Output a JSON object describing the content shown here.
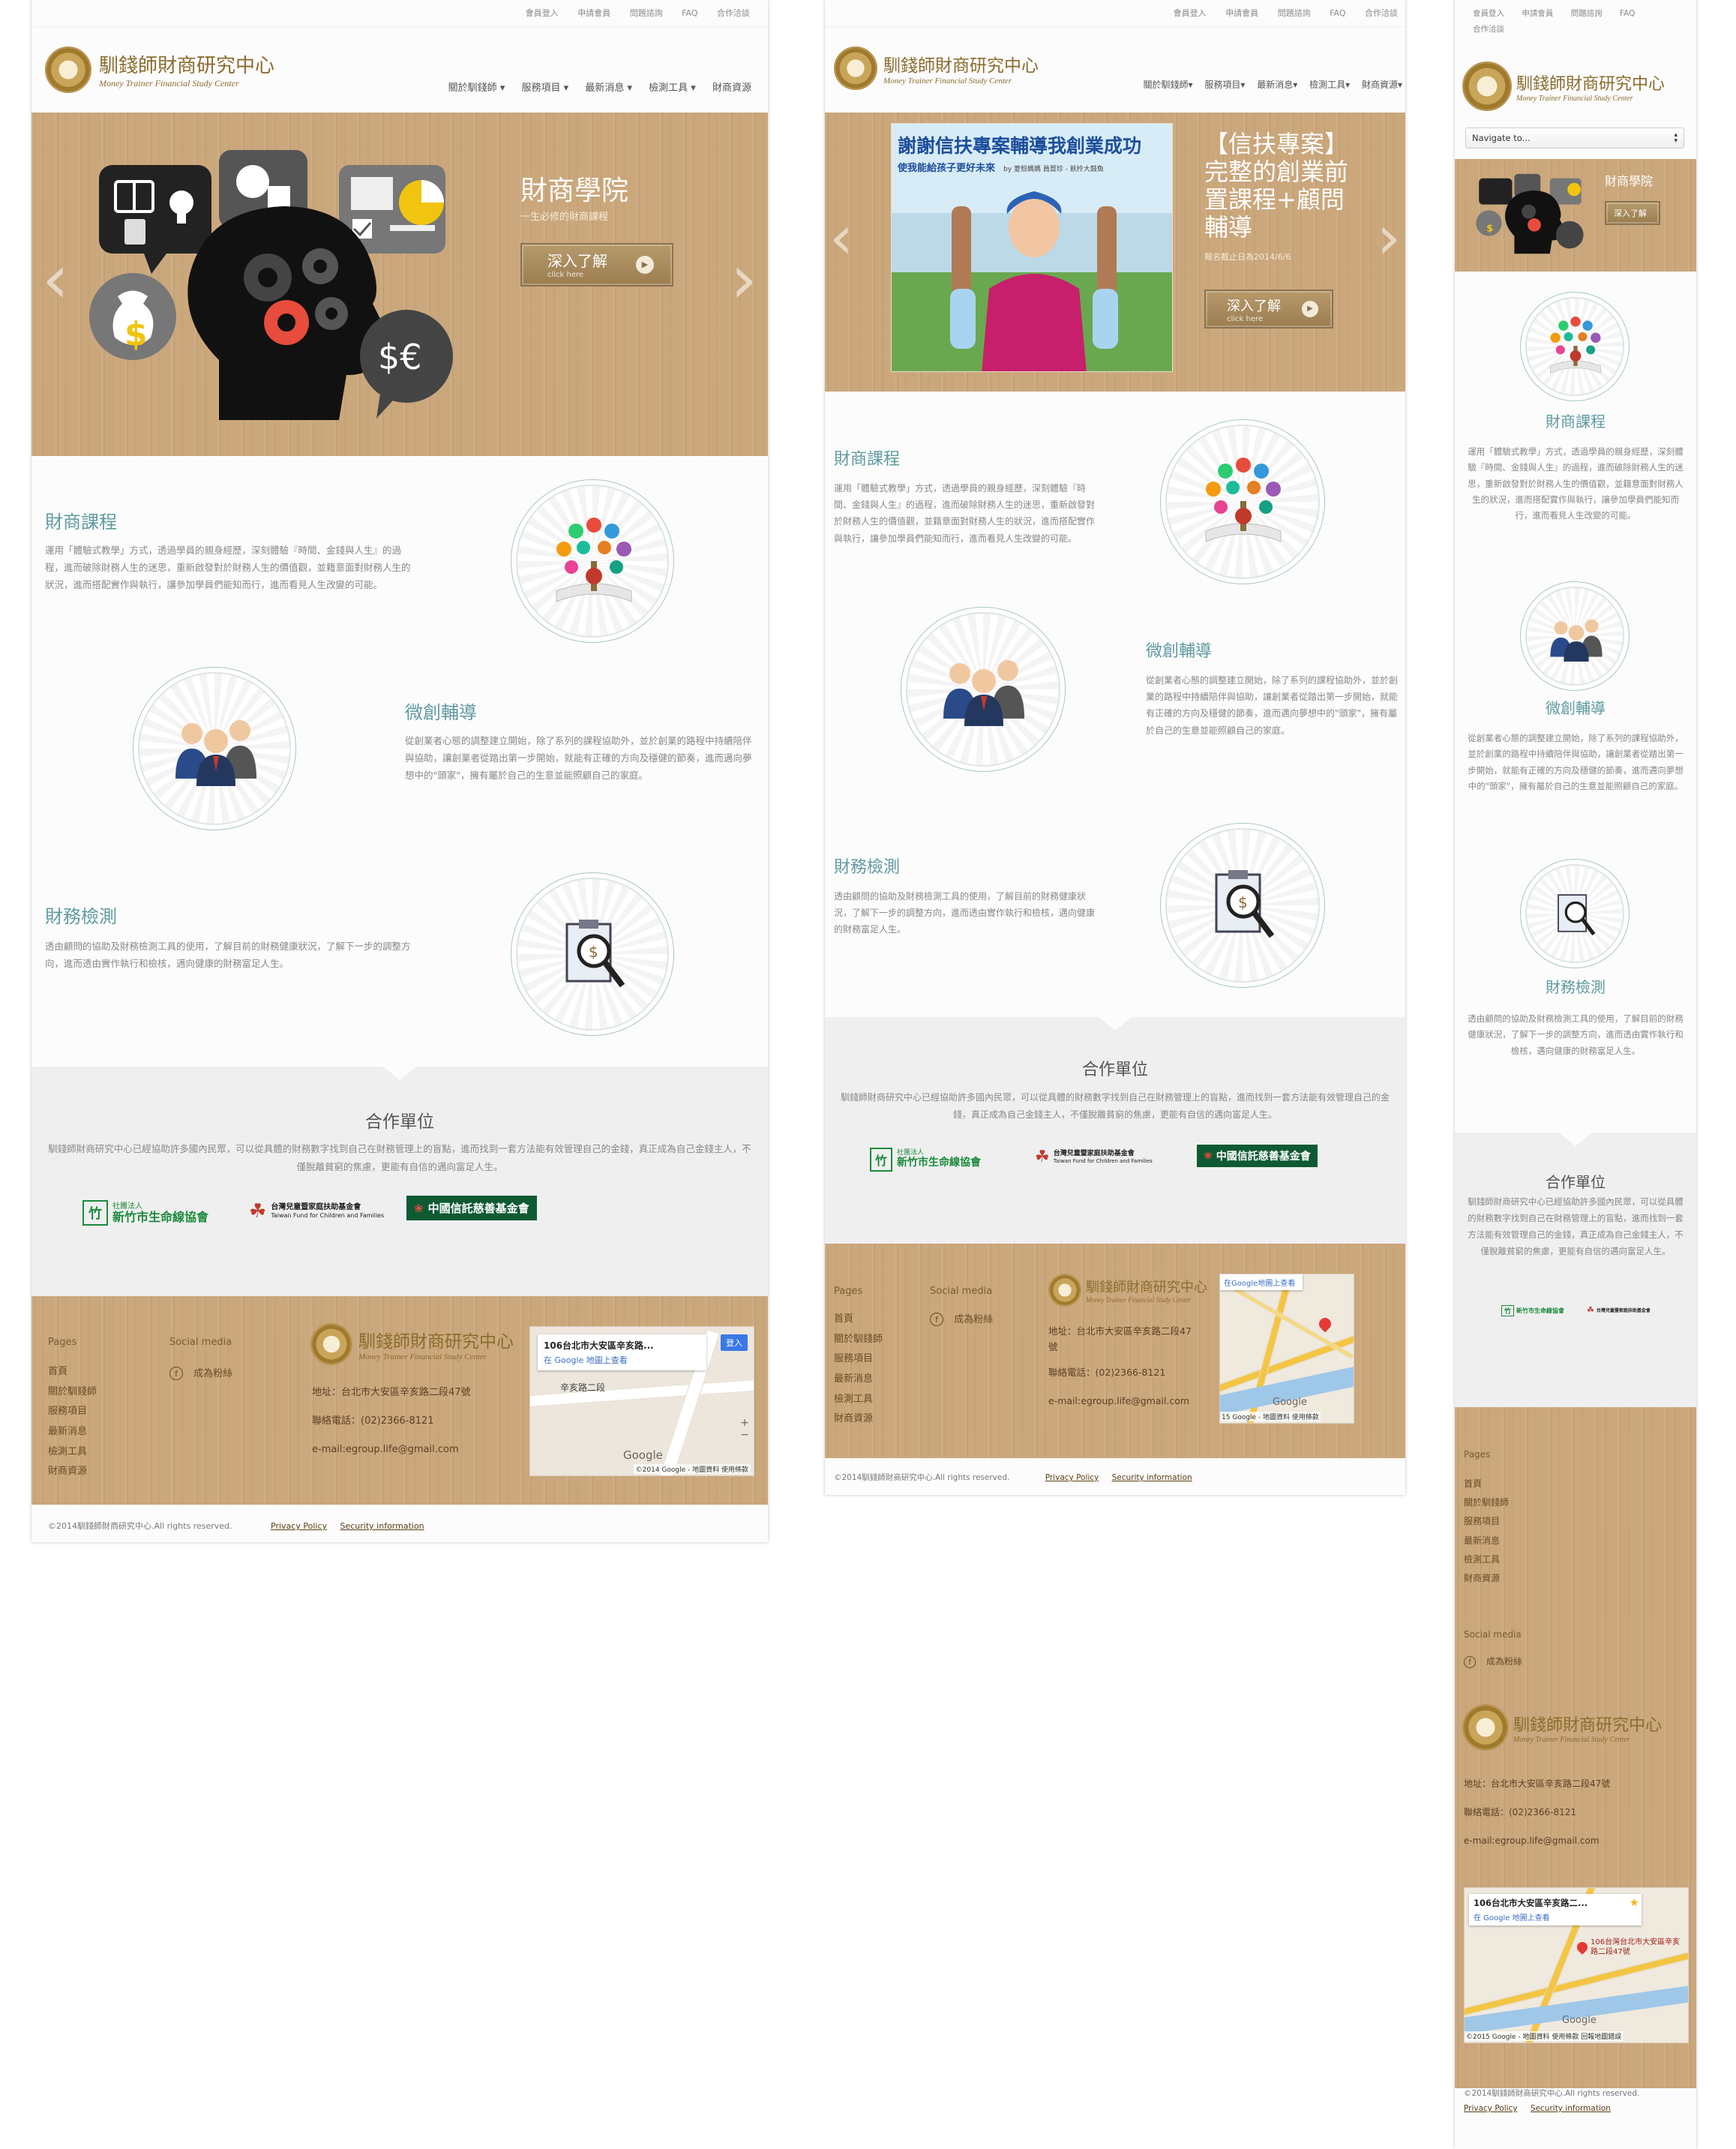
{
  "topbar": {
    "links": [
      "會員登入",
      "申請會員",
      "問題諮詢",
      "FAQ",
      "合作洽談"
    ]
  },
  "logo": {
    "name": "馴錢師財商研究中心",
    "subtitle": "Money Trainer Financial Study Center"
  },
  "nav": {
    "items": [
      "關於馴錢師",
      "服務項目",
      "最新消息",
      "檢測工具",
      "財商資源"
    ]
  },
  "mobile_nav": {
    "select_value": "Navigate to..."
  },
  "hero1": {
    "title": "財商學院",
    "subtitle": "一生必修的財商課程",
    "button": "深入了解",
    "button_sub": "click here",
    "prev": "‹",
    "next": "›"
  },
  "hero2": {
    "title": "【信扶專案】完整的創業前置課程+顧問輔導",
    "date": "報名截止日為2014/6/6",
    "banner_title": "謝謝信扶專案輔導我創業成功",
    "banner_sub": "使我能給孩子更好未來",
    "banner_by": "by 菱殼媽媽 員貿珍 - 飫拎大鼓魚",
    "button": "深入了解",
    "button_sub": "click here",
    "prev": "‹",
    "next": "›"
  },
  "services": [
    {
      "title": "財商課程",
      "text": "運用「體驗式教學」方式，透過學員的親身經歷，深刻體驗『時間、金錢與人生』的過程，進而破除財務人生的迷思，重新啟發對於財務人生的價值觀，並籍意面對財務人生的狀況，進而搭配實作與執行，讓參加學員們能知而行，進而看見人生改變的可能。",
      "icon": "course-tree-icon"
    },
    {
      "title": "微創輔導",
      "text": "從創業者心態的調整建立開始，除了系列的課程協助外，並於創業的路程中持續陪伴與協助，讓創業者從踏出第一步開始，就能有正確的方向及穩健的節奏，進而邁向夢想中的\"頭家\"，擁有屬於自己的生意並能照顧自己的家庭。",
      "icon": "consultants-icon"
    },
    {
      "title": "財務檢測",
      "text": "透由顧問的協助及財務檢測工具的使用，了解目前的財務健康狀況，了解下一步的調整方向，進而透由實作執行和檢核，邁向健康的財務富足人生。",
      "icon": "magnifier-clipboard-icon"
    }
  ],
  "partners": {
    "title": "合作單位",
    "text": "馴錢師財商研究中心已經協助許多國內民眾，可以從具體的財務數字找到自己在財務管理上的盲點，進而找到一套方法能有效管理自己的金錢，真正成為自己金錢主人，不僅脫離貧窮的焦慮，更能有自信的邁向富足人生。",
    "logos": [
      {
        "mark": "竹",
        "small": "社團法人",
        "name": "新竹市生命線協會",
        "color": "#1b8a3c"
      },
      {
        "mark": "☘",
        "small": "台灣兒童暨家庭扶助基金會",
        "name": "Taiwan Fund for Children and Families",
        "color": "#c0392b"
      },
      {
        "mark": "❀",
        "small": "",
        "name": "中國信託慈善基金會",
        "color": "#0e5a33"
      }
    ]
  },
  "footer": {
    "pages_title": "Pages",
    "pages": [
      "首頁",
      "關於馴錢師",
      "服務項目",
      "最新消息",
      "檢測工具",
      "財商資源"
    ],
    "social_title": "Social media",
    "social_icon": "facebook-icon",
    "social_label": "成為粉絲",
    "address": "地址：台北市大安區辛亥路二段47號",
    "phone": "聯絡電話：(02)2366-8121",
    "email": "e-mail:egroup.life@gmail.com",
    "map_title": "106台北市大安區辛亥路...",
    "map_title_full": "106台北市大安區辛亥路二...",
    "map_link": "在 Google 地圖上查看",
    "map_link_alt": "在Google地圖上查看",
    "map_login": "登入",
    "map_road": "辛亥路二段",
    "map_google": "Google",
    "map_attrib": "©2014 Google - 地圖資料  使用條款",
    "map_attrib2": "15 Google - 地圖資料  使用條款",
    "map_attrib3": "©2015 Google - 地圖資料  使用條款  回報地圖錯誤",
    "map_pin_label": "106台灣台北市大安區辛亥路二段47號"
  },
  "copyright": {
    "text": "©2014馴錢師財商研究中心.All rights reserved.",
    "privacy": "Privacy Policy",
    "security": "Security information"
  },
  "colors": {
    "wood": "#cba77c",
    "accent": "#5f9aa0",
    "brand": "#8a6c2e",
    "footer_text": "#6a4b23"
  }
}
